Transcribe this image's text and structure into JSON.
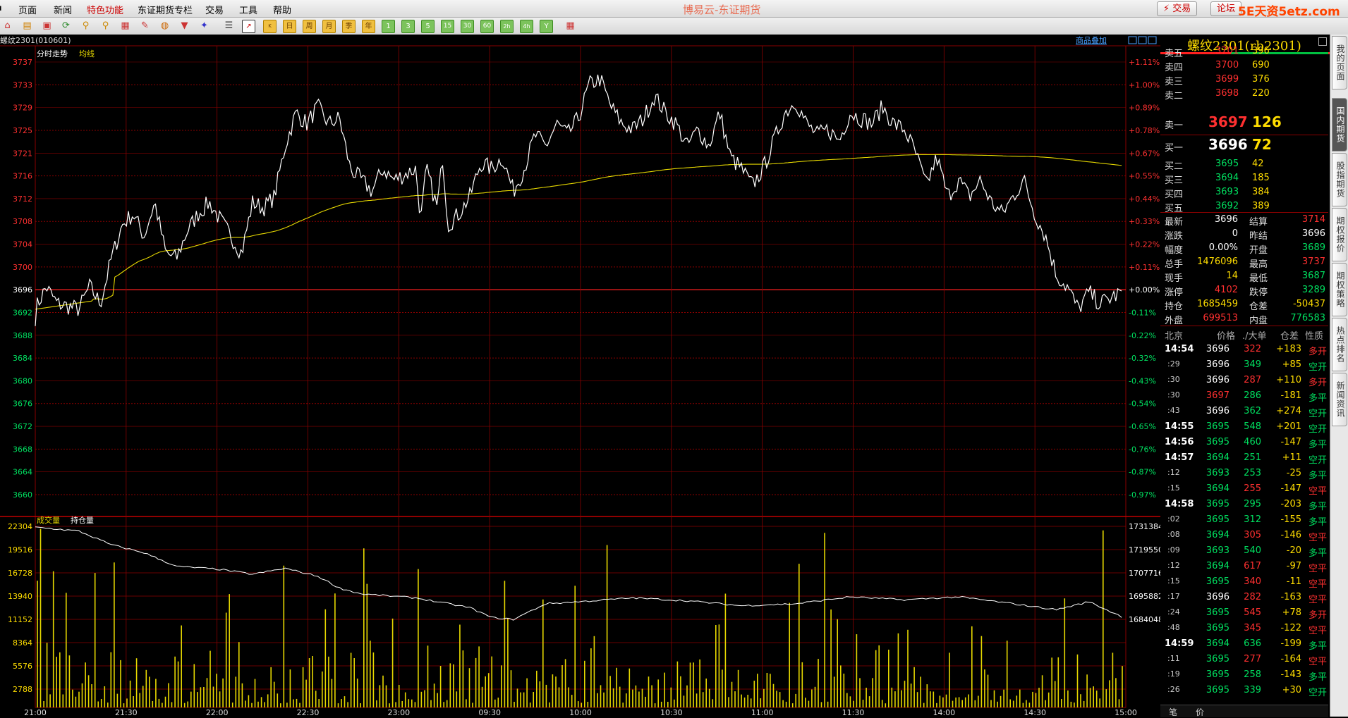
{
  "menu": {
    "items": [
      {
        "label": "页面"
      },
      {
        "label": "新闻"
      },
      {
        "label": "特色功能",
        "hot": true
      },
      {
        "label": "东证期货专栏"
      },
      {
        "label": "交易"
      },
      {
        "label": "工具"
      },
      {
        "label": "帮助"
      }
    ]
  },
  "app_title": "博易云-东证期货",
  "top_buttons": {
    "trade": "⚡ 交易",
    "forum": "论坛"
  },
  "watermark": "5E天资5etz.com",
  "toolbar": {
    "periods": [
      "日",
      "周",
      "月",
      "季",
      "年",
      "1",
      "3",
      "5",
      "15",
      "30",
      "60",
      "2h",
      "4h",
      "Y"
    ]
  },
  "chart": {
    "instrument_label": "螺纹2301(010601)",
    "overlay_button": "商品叠加",
    "price_title": "分时走势",
    "avg_label": "均线",
    "vol_title": "成交量",
    "oi_title": "持仓量",
    "price_ticks": [
      "3737",
      "3733",
      "3729",
      "3725",
      "3721",
      "3716",
      "3712",
      "3708",
      "3704",
      "3700",
      "3696",
      "3692",
      "3688",
      "3684",
      "3680",
      "3676",
      "3672",
      "3668",
      "3664",
      "3660"
    ],
    "pct_ticks": [
      "+1.11%",
      "+1.00%",
      "+0.89%",
      "+0.78%",
      "+0.67%",
      "+0.55%",
      "+0.44%",
      "+0.33%",
      "+0.22%",
      "+0.11%",
      "+0.00%",
      "-0.11%",
      "-0.22%",
      "-0.32%",
      "-0.43%",
      "-0.54%",
      "-0.65%",
      "-0.76%",
      "-0.87%",
      "-0.97%"
    ],
    "vol_ticks": [
      "22304",
      "19516",
      "16728",
      "13940",
      "11152",
      "8364",
      "5576",
      "2788"
    ],
    "oi_ticks": [
      "1731384",
      "1719550",
      "1707716",
      "1695882",
      "1684048"
    ],
    "time_labels": [
      "21:00",
      "21:30",
      "22:00",
      "22:30",
      "23:00",
      "09:30",
      "10:00",
      "10:30",
      "11:00",
      "11:30",
      "14:00",
      "14:30",
      "15:00"
    ],
    "colors": {
      "grid": "#8a0000",
      "price": "#ffffff",
      "avg": "#e6d800",
      "vol": "#e6d800",
      "up": "#ff3030",
      "down": "#00e060"
    }
  },
  "quote": {
    "title": "螺纹2301(rb2301)",
    "asks": [
      {
        "label": "卖五",
        "price": "3701",
        "vol": "396"
      },
      {
        "label": "卖四",
        "price": "3700",
        "vol": "690"
      },
      {
        "label": "卖三",
        "price": "3699",
        "vol": "376"
      },
      {
        "label": "卖二",
        "price": "3698",
        "vol": "220"
      }
    ],
    "ask1": {
      "label": "卖一",
      "price": "3697",
      "vol": "126"
    },
    "bid1": {
      "label": "买一",
      "price": "3696",
      "vol": "72"
    },
    "bids": [
      {
        "label": "买二",
        "price": "3695",
        "vol": "42"
      },
      {
        "label": "买三",
        "price": "3694",
        "vol": "185"
      },
      {
        "label": "买四",
        "price": "3693",
        "vol": "384"
      },
      {
        "label": "买五",
        "price": "3692",
        "vol": "389"
      }
    ],
    "stats": [
      {
        "l1": "最新",
        "v1": "3696",
        "c1": "#ffffff",
        "l2": "结算",
        "v2": "3714",
        "c2": "#ff3030"
      },
      {
        "l1": "涨跌",
        "v1": "0",
        "c1": "#ffffff",
        "l2": "昨结",
        "v2": "3696",
        "c2": "#ffffff"
      },
      {
        "l1": "幅度",
        "v1": "0.00%",
        "c1": "#ffffff",
        "l2": "开盘",
        "v2": "3689",
        "c2": "#00e060"
      },
      {
        "l1": "总手",
        "v1": "1476096",
        "c1": "#ffdd00",
        "l2": "最高",
        "v2": "3737",
        "c2": "#ff3030"
      },
      {
        "l1": "现手",
        "v1": "14",
        "c1": "#ffdd00",
        "l2": "最低",
        "v2": "3687",
        "c2": "#00e060"
      },
      {
        "l1": "涨停",
        "v1": "4102",
        "c1": "#ff3030",
        "l2": "跌停",
        "v2": "3289",
        "c2": "#00e060"
      },
      {
        "l1": "持仓",
        "v1": "1685459",
        "c1": "#ffdd00",
        "l2": "仓差",
        "v2": "-50437",
        "c2": "#ffdd00"
      },
      {
        "l1": "外盘",
        "v1": "699513",
        "c1": "#ff3030",
        "l2": "内盘",
        "v2": "776583",
        "c2": "#00e060"
      }
    ],
    "tick_header": {
      "time": "北京",
      "price": "价格",
      "vol": "./大单",
      "oi": "仓差",
      "nature": "性质"
    },
    "ticks": [
      {
        "t": "14:54",
        "big": true,
        "p": "3696",
        "pc": "#ffffff",
        "v": "322",
        "vc": "#ff3030",
        "oi": "+183",
        "n": "多开",
        "nc": "#ff3030"
      },
      {
        "t": ":29",
        "big": false,
        "p": "3696",
        "pc": "#ffffff",
        "v": "349",
        "vc": "#00e060",
        "oi": "+85",
        "n": "空开",
        "nc": "#00e060"
      },
      {
        "t": ":30",
        "big": false,
        "p": "3696",
        "pc": "#ffffff",
        "v": "287",
        "vc": "#ff3030",
        "oi": "+110",
        "n": "多开",
        "nc": "#ff3030"
      },
      {
        "t": ":30",
        "big": false,
        "p": "3697",
        "pc": "#ff3030",
        "v": "286",
        "vc": "#00e060",
        "oi": "-181",
        "n": "多平",
        "nc": "#00e060"
      },
      {
        "t": ":43",
        "big": false,
        "p": "3696",
        "pc": "#ffffff",
        "v": "362",
        "vc": "#00e060",
        "oi": "+274",
        "n": "空开",
        "nc": "#00e060"
      },
      {
        "t": "14:55",
        "big": true,
        "p": "3695",
        "pc": "#00e060",
        "v": "548",
        "vc": "#00e060",
        "oi": "+201",
        "n": "空开",
        "nc": "#00e060"
      },
      {
        "t": "14:56",
        "big": true,
        "p": "3695",
        "pc": "#00e060",
        "v": "460",
        "vc": "#00e060",
        "oi": "-147",
        "n": "多平",
        "nc": "#00e060"
      },
      {
        "t": "14:57",
        "big": true,
        "p": "3694",
        "pc": "#00e060",
        "v": "251",
        "vc": "#00e060",
        "oi": "+11",
        "n": "空开",
        "nc": "#00e060"
      },
      {
        "t": ":12",
        "big": false,
        "p": "3693",
        "pc": "#00e060",
        "v": "253",
        "vc": "#00e060",
        "oi": "-25",
        "n": "多平",
        "nc": "#00e060"
      },
      {
        "t": ":15",
        "big": false,
        "p": "3694",
        "pc": "#00e060",
        "v": "255",
        "vc": "#ff3030",
        "oi": "-147",
        "n": "空平",
        "nc": "#ff3030"
      },
      {
        "t": "14:58",
        "big": true,
        "p": "3695",
        "pc": "#00e060",
        "v": "295",
        "vc": "#00e060",
        "oi": "-203",
        "n": "多平",
        "nc": "#00e060"
      },
      {
        "t": ":02",
        "big": false,
        "p": "3695",
        "pc": "#00e060",
        "v": "312",
        "vc": "#00e060",
        "oi": "-155",
        "n": "多平",
        "nc": "#00e060"
      },
      {
        "t": ":08",
        "big": false,
        "p": "3694",
        "pc": "#00e060",
        "v": "305",
        "vc": "#ff3030",
        "oi": "-146",
        "n": "空平",
        "nc": "#ff3030"
      },
      {
        "t": ":09",
        "big": false,
        "p": "3693",
        "pc": "#00e060",
        "v": "540",
        "vc": "#00e060",
        "oi": "-20",
        "n": "多平",
        "nc": "#00e060"
      },
      {
        "t": ":12",
        "big": false,
        "p": "3694",
        "pc": "#00e060",
        "v": "617",
        "vc": "#ff3030",
        "oi": "-97",
        "n": "空平",
        "nc": "#ff3030"
      },
      {
        "t": ":15",
        "big": false,
        "p": "3695",
        "pc": "#00e060",
        "v": "340",
        "vc": "#ff3030",
        "oi": "-11",
        "n": "空平",
        "nc": "#ff3030"
      },
      {
        "t": ":17",
        "big": false,
        "p": "3696",
        "pc": "#ffffff",
        "v": "282",
        "vc": "#ff3030",
        "oi": "-163",
        "n": "空平",
        "nc": "#ff3030"
      },
      {
        "t": ":24",
        "big": false,
        "p": "3695",
        "pc": "#00e060",
        "v": "545",
        "vc": "#ff3030",
        "oi": "+78",
        "n": "多开",
        "nc": "#ff3030"
      },
      {
        "t": ":48",
        "big": false,
        "p": "3695",
        "pc": "#00e060",
        "v": "345",
        "vc": "#ff3030",
        "oi": "-122",
        "n": "空平",
        "nc": "#ff3030"
      },
      {
        "t": "14:59",
        "big": true,
        "p": "3694",
        "pc": "#00e060",
        "v": "636",
        "vc": "#00e060",
        "oi": "-199",
        "n": "多平",
        "nc": "#00e060"
      },
      {
        "t": ":11",
        "big": false,
        "p": "3695",
        "pc": "#00e060",
        "v": "277",
        "vc": "#ff3030",
        "oi": "-164",
        "n": "空平",
        "nc": "#ff3030"
      },
      {
        "t": ":19",
        "big": false,
        "p": "3695",
        "pc": "#00e060",
        "v": "258",
        "vc": "#00e060",
        "oi": "-143",
        "n": "多平",
        "nc": "#00e060"
      },
      {
        "t": ":26",
        "big": false,
        "p": "3695",
        "pc": "#00e060",
        "v": "339",
        "vc": "#00e060",
        "oi": "+30",
        "n": "空开",
        "nc": "#00e060"
      }
    ],
    "bottom_tabs": [
      "笔",
      "价"
    ]
  },
  "sidebar": {
    "tabs": [
      "我的页面",
      "国内期货",
      "股指期货",
      "期权报价",
      "期权策略",
      "热点排名",
      "新闻资讯"
    ]
  }
}
